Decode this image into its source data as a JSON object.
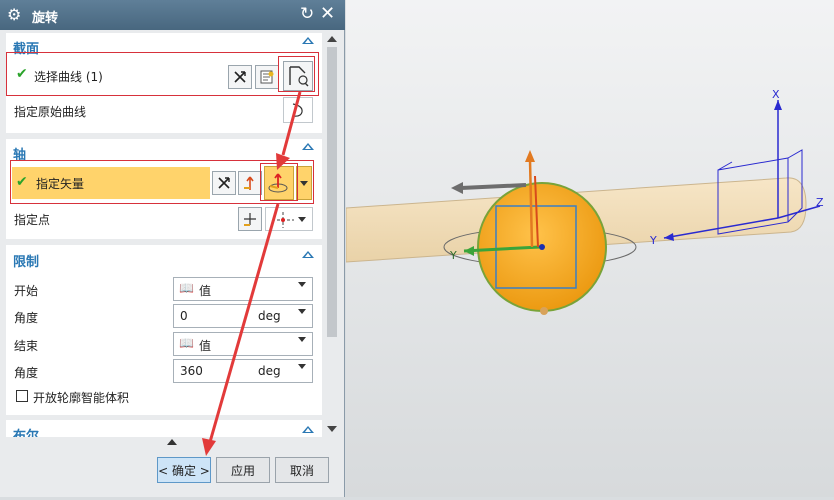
{
  "dialog": {
    "title": "旋转",
    "section": {
      "title": "截面",
      "select_curve_label": "选择曲线 (1)",
      "specify_origin_curve_label": "指定原始曲线"
    },
    "axis": {
      "title": "轴",
      "specify_vector_label": "指定矢量",
      "specify_point_label": "指定点"
    },
    "limits": {
      "title": "限制",
      "start_label": "开始",
      "start_mode": "值",
      "start_angle_label": "角度",
      "start_angle_value": "0",
      "start_angle_unit": "deg",
      "end_label": "结束",
      "end_mode": "值",
      "end_angle_label": "角度",
      "end_angle_value": "360",
      "end_angle_unit": "deg",
      "open_profile_label": "开放轮廓智能体积",
      "open_profile_checked": false
    },
    "boolean": {
      "title": "布尔"
    },
    "buttons": {
      "ok": "< 确定 >",
      "apply": "应用",
      "cancel": "取消"
    }
  },
  "viewport": {
    "labels": {
      "x": "X",
      "y_right": "Y",
      "z": "Z",
      "y_left": "Y"
    }
  },
  "colors": {
    "title_bar": "#48677f",
    "section_title": "#2a78b4",
    "highlight_row": "#ffd36b",
    "annotation_red": "#e23a3a",
    "cylinder": "#f3dfb8",
    "sphere": "#f2a51c",
    "csys_blue": "#2a2ad0",
    "check_green": "#2aa32a"
  },
  "icons": [
    "gear-icon",
    "reset-icon",
    "close-icon",
    "collapse-caret-icon",
    "check-icon",
    "deselect-icon",
    "curve-rule-icon",
    "section-curve-icon",
    "vector-dialog-icon",
    "inferred-vector-icon",
    "point-dialog-icon",
    "point-inferred-icon",
    "values-icon",
    "scroll-up-icon",
    "scroll-down-icon"
  ]
}
